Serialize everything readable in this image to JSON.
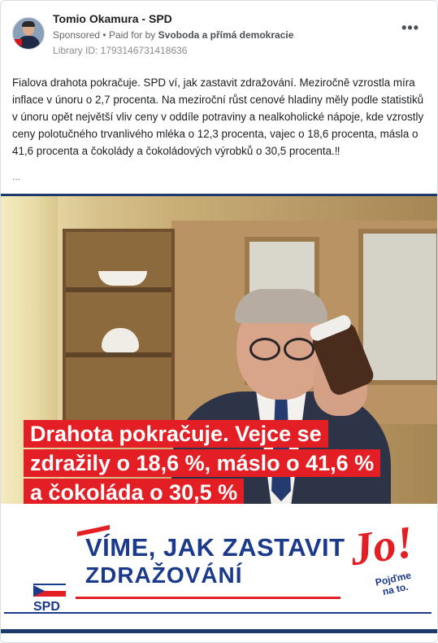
{
  "post": {
    "author": "Tomio Okamura - SPD",
    "sponsored_label": "Sponsored",
    "separator": "•",
    "paid_for_prefix": "Paid for by",
    "paid_for_by": "Svoboda a přímá demokracie",
    "library_id": "Library ID: 1793146731418636",
    "more_icon": "more-options-icon",
    "body": "Fialova drahota pokračuje. SPD ví, jak zastavit zdražování. Meziročně vzrostla míra inflace v únoru o 2,7 procenta. Na meziroční růst cenové hladiny měly podle statistiků v únoru opět největší vliv ceny v oddíle potraviny a nealkoholické nápoje, kde vzrostly ceny polotučného trvanlivého mléka o 12,3 procenta, vajec o 18,6 procenta, másla o 41,6 procenta a čokolády a čokoládových výrobků o 30,5 procenta.‼",
    "ellipsis": "..."
  },
  "media": {
    "caption_lines": [
      "Drahota pokračuje. Vejce se",
      "zdražily o 18,6 %, máslo o 41,6 %",
      "a čokoláda o 30,5 %"
    ],
    "slogan_line1": "VÍME, JAK ZASTAVIT",
    "slogan_line2": "ZDRAŽOVÁNÍ",
    "jo_text": "Jo!",
    "pojdme_line1": "Pojďme",
    "pojdme_line2": "na to.",
    "party_logo_text": "SPD"
  },
  "colors": {
    "accent_red": "#e31e24",
    "brand_blue": "#1b3a8c"
  }
}
